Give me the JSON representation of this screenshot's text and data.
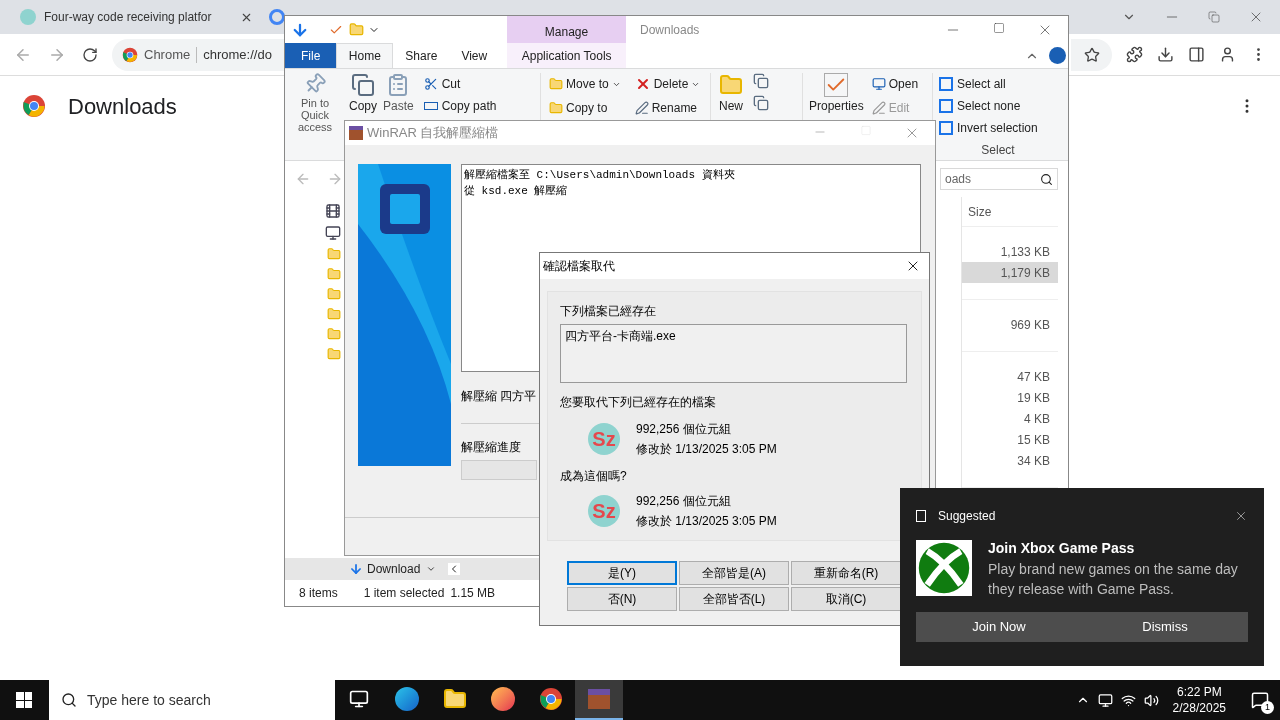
{
  "browser": {
    "tab_title": "Four-way code receiving platfor",
    "address_label": "Chrome",
    "address": "chrome://do",
    "page_title": "Downloads"
  },
  "explorer": {
    "title": "Downloads",
    "context_group": "Manage",
    "tabs": [
      {
        "label": "File",
        "kind": "file",
        "selected": false
      },
      {
        "label": "Home",
        "kind": "tab",
        "selected": true
      },
      {
        "label": "Share",
        "kind": "tab",
        "selected": false
      },
      {
        "label": "View",
        "kind": "tab",
        "selected": false
      },
      {
        "label": "Application Tools",
        "kind": "context",
        "selected": false
      }
    ],
    "clipboard": {
      "pin": "Pin to Quick access",
      "copy": "Copy",
      "paste": "Paste",
      "cut": "Cut",
      "copy_path": "Copy path"
    },
    "organize": {
      "move_to": "Move to",
      "copy_to": "Copy to",
      "delete": "Delete",
      "rename": "Rename"
    },
    "new": "New",
    "open": {
      "properties": "Properties",
      "open": "Open",
      "edit": "Edit"
    },
    "select": {
      "items": [
        "Select all",
        "Select none",
        "Invert selection"
      ],
      "label": "Select"
    },
    "search_placeholder": "oads",
    "size_column": "Size",
    "size_groups": [
      [
        {
          "size": "1,133 KB",
          "selected": false
        },
        {
          "size": "1,179 KB",
          "selected": true
        }
      ],
      [
        {
          "size": "969 KB",
          "selected": false
        }
      ],
      [
        {
          "size": "47 KB",
          "selected": false
        },
        {
          "size": "19 KB",
          "selected": false
        },
        {
          "size": "4 KB",
          "selected": false
        },
        {
          "size": "15 KB",
          "selected": false
        },
        {
          "size": "34 KB",
          "selected": false
        }
      ]
    ],
    "nav_item": "Download",
    "status": {
      "count": "8 items",
      "selection": "1 item selected",
      "size": "1.15 MB"
    }
  },
  "winrar": {
    "title": "WinRAR 自我解壓縮檔",
    "log": [
      "解壓縮檔案至 C:\\Users\\admin\\Downloads 資料夾",
      "從 ksd.exe 解壓縮"
    ],
    "current": "解壓縮 四方平",
    "progress_label": "解壓縮進度",
    "progress": {
      "level": 0
    }
  },
  "confirm": {
    "title": "確認檔案取代",
    "exists_label": "下列檔案已經存在",
    "file_name": "四方平台-卡商端.exe",
    "replace_question": "您要取代下列已經存在的檔案",
    "existing": {
      "icon_label": "Sz",
      "size": "992,256 個位元組",
      "modified": "修改於 1/13/2025 3:05 PM"
    },
    "with_label": "成為這個嗎?",
    "incoming": {
      "icon_label": "Sz",
      "size": "992,256 個位元組",
      "modified": "修改於 1/13/2025 3:05 PM"
    },
    "buttons": [
      {
        "label": "是(Y)",
        "selected": true
      },
      {
        "label": "全部皆是(A)",
        "selected": false
      },
      {
        "label": "重新命名(R)",
        "selected": false
      },
      {
        "label": "否(N)",
        "selected": false
      },
      {
        "label": "全部皆否(L)",
        "selected": false
      },
      {
        "label": "取消(C)",
        "selected": false
      }
    ]
  },
  "notification": {
    "header": "Suggested",
    "title": "Join Xbox Game Pass",
    "body": "Play brand new games on the same day they release with Game Pass.",
    "actions": [
      "Join Now",
      "Dismiss"
    ]
  },
  "taskbar": {
    "search_placeholder": "Type here to search",
    "apps": [
      {
        "kind": "taskview",
        "selected": false
      },
      {
        "kind": "edge",
        "selected": false
      },
      {
        "kind": "explorer",
        "selected": false
      },
      {
        "kind": "firefox",
        "selected": false
      },
      {
        "kind": "chrome",
        "selected": false
      },
      {
        "kind": "winrar",
        "selected": true
      }
    ],
    "time": "6:22 PM",
    "date": "2/28/2025",
    "notification_count": "1"
  }
}
